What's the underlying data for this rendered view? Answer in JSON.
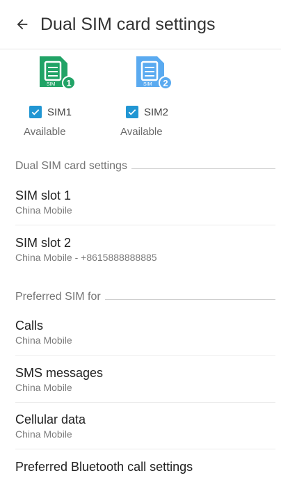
{
  "header": {
    "title": "Dual SIM card settings"
  },
  "sims": [
    {
      "badge_text": "SIM",
      "number": "1",
      "color": "#21a366",
      "checkbox_label": "SIM1",
      "status": "Available",
      "checked": true
    },
    {
      "badge_text": "SIM",
      "number": "2",
      "color": "#5aaaf0",
      "checkbox_label": "SIM2",
      "status": "Available",
      "checked": true
    }
  ],
  "sections": {
    "dual_sim": {
      "label": "Dual SIM card settings"
    },
    "preferred": {
      "label": "Preferred SIM for"
    }
  },
  "items": {
    "slot1": {
      "title": "SIM slot 1",
      "subtitle": "China Mobile"
    },
    "slot2": {
      "title": "SIM slot 2",
      "subtitle": "China Mobile - +8615888888885"
    },
    "calls": {
      "title": "Calls",
      "subtitle": "China Mobile"
    },
    "sms": {
      "title": "SMS messages",
      "subtitle": "China Mobile"
    },
    "data": {
      "title": "Cellular data",
      "subtitle": "China Mobile"
    },
    "bluetooth": {
      "title": "Preferred Bluetooth call settings"
    }
  },
  "colors": {
    "accent": "#2196d3",
    "sim1": "#21a366",
    "sim2": "#5aaaf0"
  }
}
